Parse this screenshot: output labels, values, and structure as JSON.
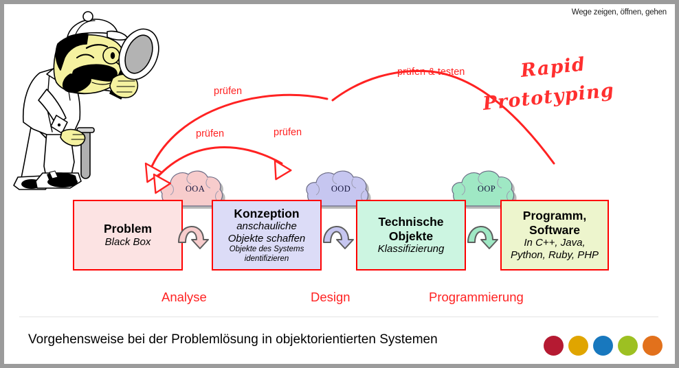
{
  "header": {
    "tagline": "Wege zeigen, öffnen, gehen"
  },
  "annotations": {
    "pruefen_1": "prüfen",
    "pruefen_2": "prüfen",
    "pruefen_3": "prüfen",
    "pruefen_testen": "prüfen & testen",
    "rapid_line1": "Rapid",
    "rapid_line2": "Prototyping",
    "accent_color": "#ff2222"
  },
  "clouds": [
    {
      "name": "ooa",
      "label": "OOA",
      "fill": "#f7cccc"
    },
    {
      "name": "ood",
      "label": "OOD",
      "fill": "#c6c6f0"
    },
    {
      "name": "oop",
      "label": "OOP",
      "fill": "#9fe8c4"
    }
  ],
  "stages": [
    {
      "name": "problem",
      "title": "Problem",
      "sub1": "Black Box",
      "sub2": "",
      "sub3": "",
      "fill": "#fce3e3",
      "border": "#ff0000"
    },
    {
      "name": "konzeption",
      "title": "Konzeption",
      "sub1": "anschauliche",
      "sub2": "Objekte schaffen",
      "sub3": "Objekte des Systems identifizieren",
      "fill": "#dcdcf7",
      "border": "#ff0000"
    },
    {
      "name": "technische-objekte",
      "title": "Technische Objekte",
      "sub1": "Klassifizierung",
      "sub2": "",
      "sub3": "",
      "fill": "#ccf5e1",
      "border": "#ff0000"
    },
    {
      "name": "programm-software",
      "title": "Programm, Software",
      "sub1": "In C++, Java,",
      "sub2": "Python, Ruby, PHP",
      "sub3": "",
      "fill": "#edf5cd",
      "border": "#ff0000"
    }
  ],
  "phases": [
    {
      "name": "analyse",
      "label": "Analyse"
    },
    {
      "name": "design",
      "label": "Design"
    },
    {
      "name": "programmierung",
      "label": "Programmierung"
    }
  ],
  "footer": {
    "title": "Vorgehensweise bei der Problemlösung in objektorientierten Systemen",
    "logo_dots": [
      "#b51a32",
      "#e0a500",
      "#1878be",
      "#9dc022",
      "#e2711c"
    ]
  },
  "illustration": {
    "name": "detective-with-magnifier",
    "skin": "#f5f2a0",
    "coat": "#ffffff",
    "hair": "#000000",
    "lens": "#b3b3b3"
  }
}
